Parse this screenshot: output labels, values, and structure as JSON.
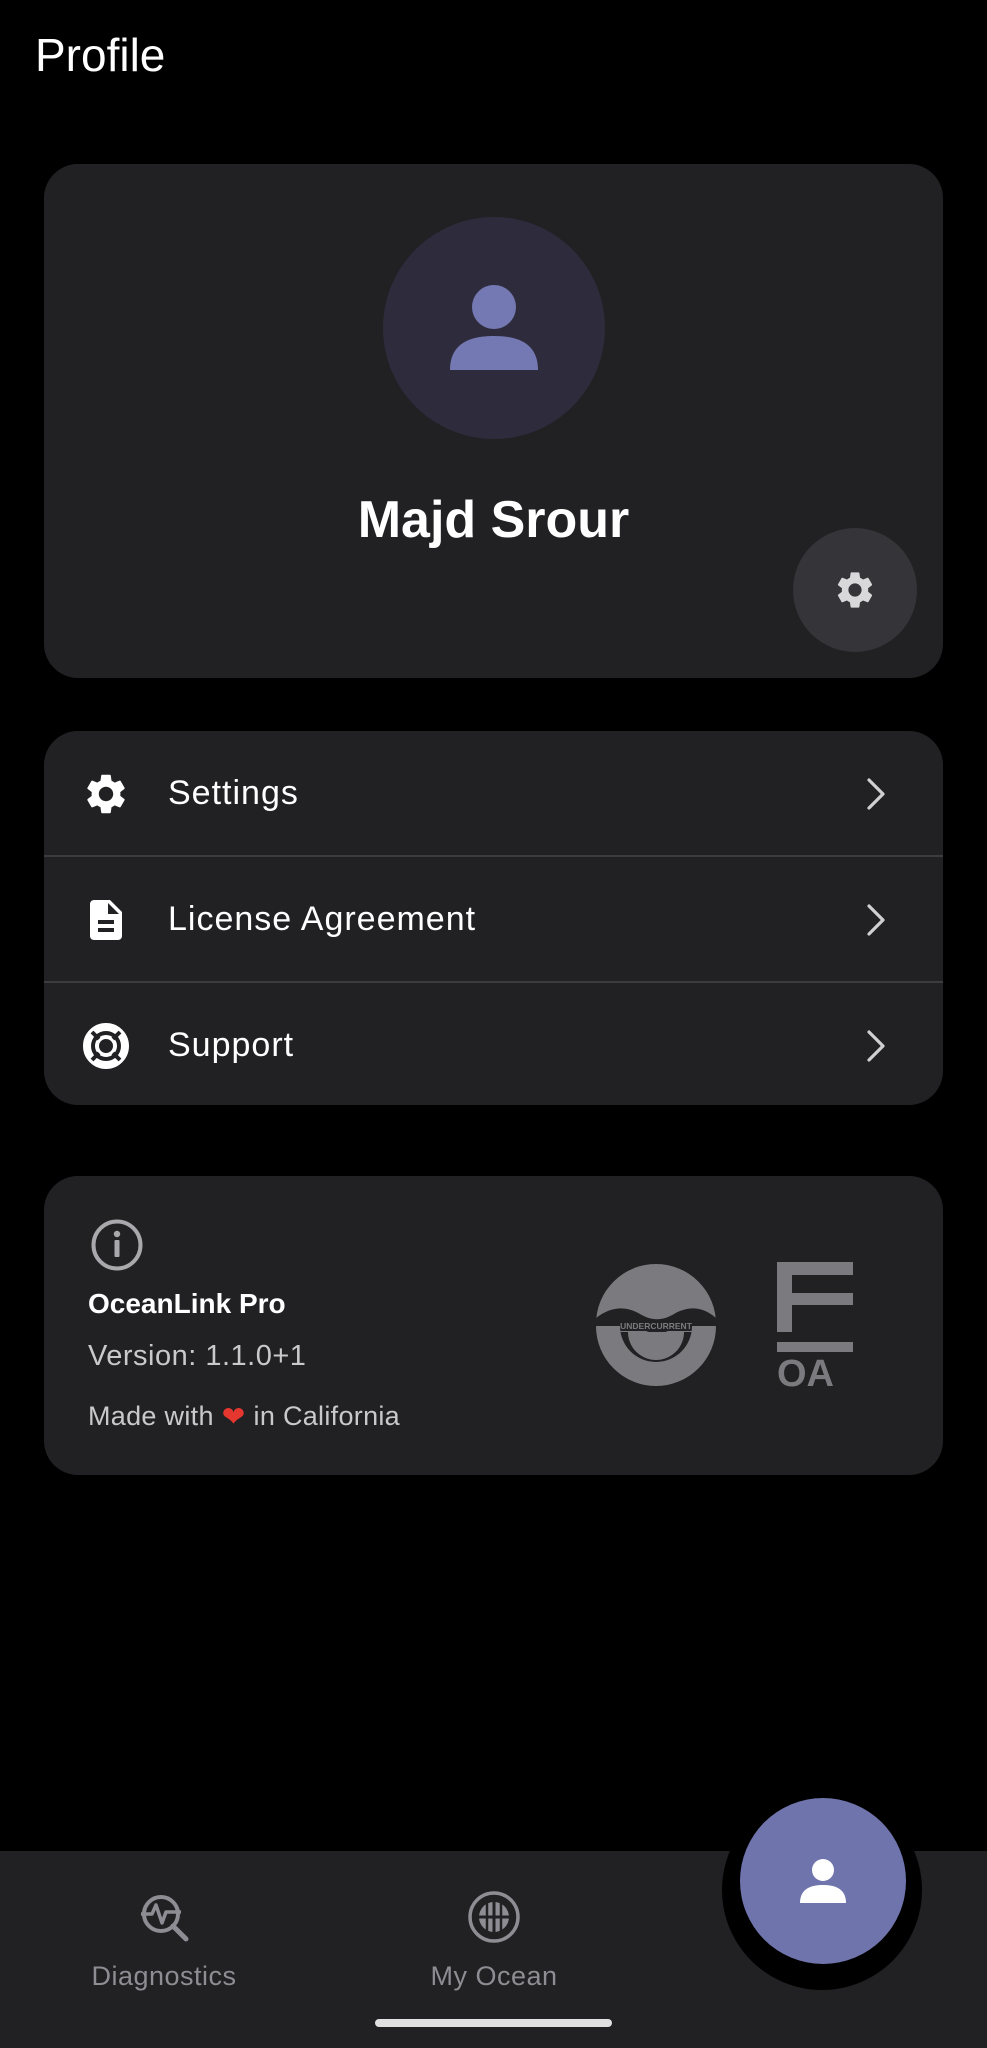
{
  "header": {
    "title": "Profile"
  },
  "profile": {
    "name": "Majd Srour"
  },
  "menu": {
    "items": [
      {
        "label": "Settings",
        "icon": "gear-icon"
      },
      {
        "label": "License Agreement",
        "icon": "document-icon"
      },
      {
        "label": "Support",
        "icon": "lifebuoy-icon"
      }
    ]
  },
  "about": {
    "app_name": "OceanLink Pro",
    "version": "Version: 1.1.0+1",
    "made_with_prefix": "Made with",
    "made_with_suffix": "in California",
    "partner_logos": [
      "UNDERCURRENT",
      "FOA"
    ]
  },
  "bottom_nav": {
    "items": [
      {
        "label": "Diagnostics",
        "icon": "diagnostics-icon"
      },
      {
        "label": "My Ocean",
        "icon": "globe-icon"
      }
    ],
    "active": "profile-icon"
  },
  "colors": {
    "background": "#000000",
    "card": "#212023",
    "accent": "#6f74ad",
    "heart": "#e5372f",
    "muted_text": "#8e8d93"
  }
}
